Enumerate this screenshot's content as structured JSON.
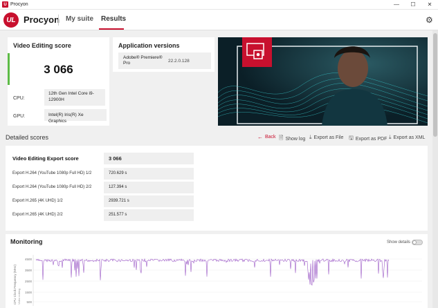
{
  "window": {
    "title": "Procyon",
    "controls": [
      "—",
      "☐",
      "✕"
    ]
  },
  "header": {
    "logo_text": "UL",
    "brand": "Procyon",
    "nav": [
      {
        "label": "My suite",
        "active": false
      },
      {
        "label": "Results",
        "active": true
      }
    ]
  },
  "score_card": {
    "title": "Video Editing score",
    "score": "3 066",
    "cpu_label": "CPU:",
    "cpu_value": "12th Gen Intel Core i9-12900H",
    "gpu_label": "GPU:",
    "gpu_value": "Intel(R) Iris(R) Xe Graphics"
  },
  "app_versions": {
    "title": "Application versions",
    "app_name": "Adobe® Premiere® Pro",
    "app_version": "22.2.0.128"
  },
  "detailed": {
    "title": "Detailed scores",
    "actions": {
      "back": "Back",
      "show_log": "Show log",
      "export_file": "Export as File",
      "export_pdf": "Export as PDF",
      "export_xml": "Export as XML"
    },
    "rows": [
      {
        "label": "Video Editing Export score",
        "value": "3 066"
      },
      {
        "label": "Export H.264 (YouTube 1080p Full HD) 1/2",
        "value": "720.629 s"
      },
      {
        "label": "Export H.264 (YouTube 1080p Full HD) 2/2",
        "value": "127.394 s"
      },
      {
        "label": "Export H.265 (4K UHD) 1/2",
        "value": "2939.721 s"
      },
      {
        "label": "Export H.265 (4K UHD) 2/2",
        "value": "251.577 s"
      }
    ]
  },
  "monitoring": {
    "title": "Monitoring",
    "show_details": "Show details",
    "y_label": "CPU Clock Frequency (MHz)",
    "y_sublabel": "Video editing",
    "y_ticks": [
      "4500",
      "3500",
      "2500",
      "1500",
      "500"
    ],
    "line_color": "#9b59c6"
  },
  "colors": {
    "accent_red": "#c8102e",
    "score_green": "#5dbb46"
  }
}
